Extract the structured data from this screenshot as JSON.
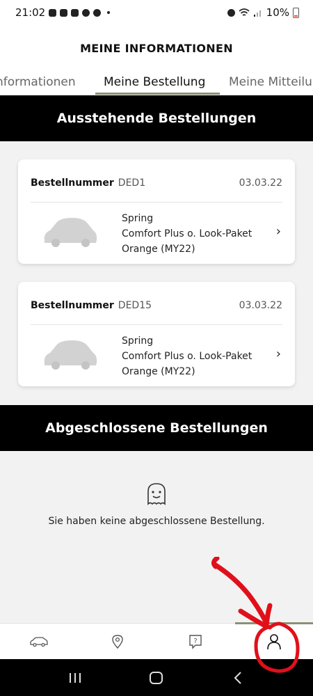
{
  "status_bar": {
    "time": "21:02",
    "battery": "10%"
  },
  "header": {
    "title": "MEINE INFORMATIONEN",
    "tabs": [
      {
        "label": "nformationen"
      },
      {
        "label": "Meine Bestellung"
      },
      {
        "label": "Meine Mitteilu"
      }
    ],
    "active_tab": "Meine Bestellung"
  },
  "pending": {
    "title": "Ausstehende Bestellungen",
    "orders": [
      {
        "order_label": "Bestellnummer",
        "order_number": "DED1",
        "date": "03.03.22",
        "model": "Spring",
        "trim": "Comfort Plus o. Look-Paket",
        "color": "Orange (MY22)"
      },
      {
        "order_label": "Bestellnummer",
        "order_number": "DED15",
        "date": "03.03.22",
        "model": "Spring",
        "trim": "Comfort Plus o. Look-Paket",
        "color": "Orange (MY22)"
      }
    ]
  },
  "completed": {
    "title": "Abgeschlossene Bestellungen",
    "empty_text": "Sie haben keine abgeschlossene Bestellung."
  },
  "bottom_nav": {
    "items": [
      {
        "icon": "car-icon"
      },
      {
        "icon": "location-pin-icon"
      },
      {
        "icon": "help-icon"
      },
      {
        "icon": "profile-icon"
      }
    ],
    "active_index": 3
  },
  "colors": {
    "accent": "#8c8f76",
    "annotation": "#e0101a"
  }
}
